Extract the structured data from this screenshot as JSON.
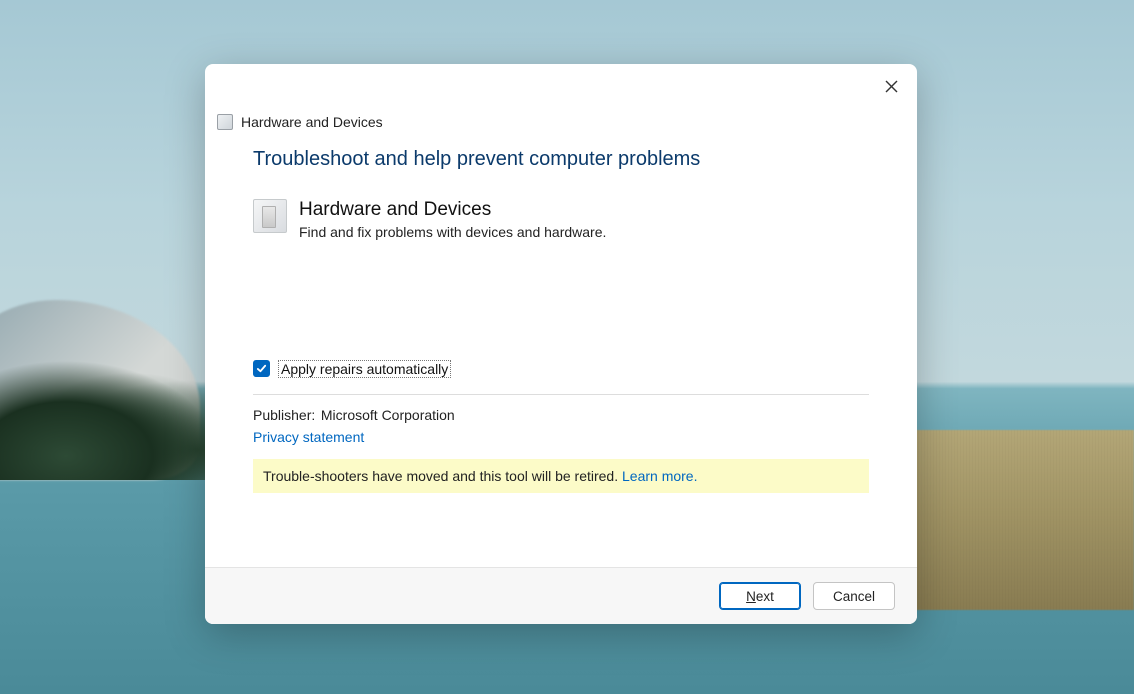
{
  "window": {
    "title": "Hardware and Devices"
  },
  "content": {
    "heading": "Troubleshoot and help prevent computer problems",
    "troubleshooter": {
      "icon_name": "hardware-devices-icon",
      "title": "Hardware and Devices",
      "description": "Find and fix problems with devices and hardware."
    },
    "checkbox": {
      "checked": true,
      "label": "Apply repairs automatically"
    },
    "publisher": {
      "label": "Publisher:",
      "value": "Microsoft Corporation"
    },
    "privacy_link": "Privacy statement",
    "notice": {
      "text": "Trouble-shooters have moved and this tool will be retired. ",
      "link": "Learn more."
    }
  },
  "footer": {
    "next": {
      "accel": "N",
      "rest": "ext"
    },
    "cancel": "Cancel"
  }
}
